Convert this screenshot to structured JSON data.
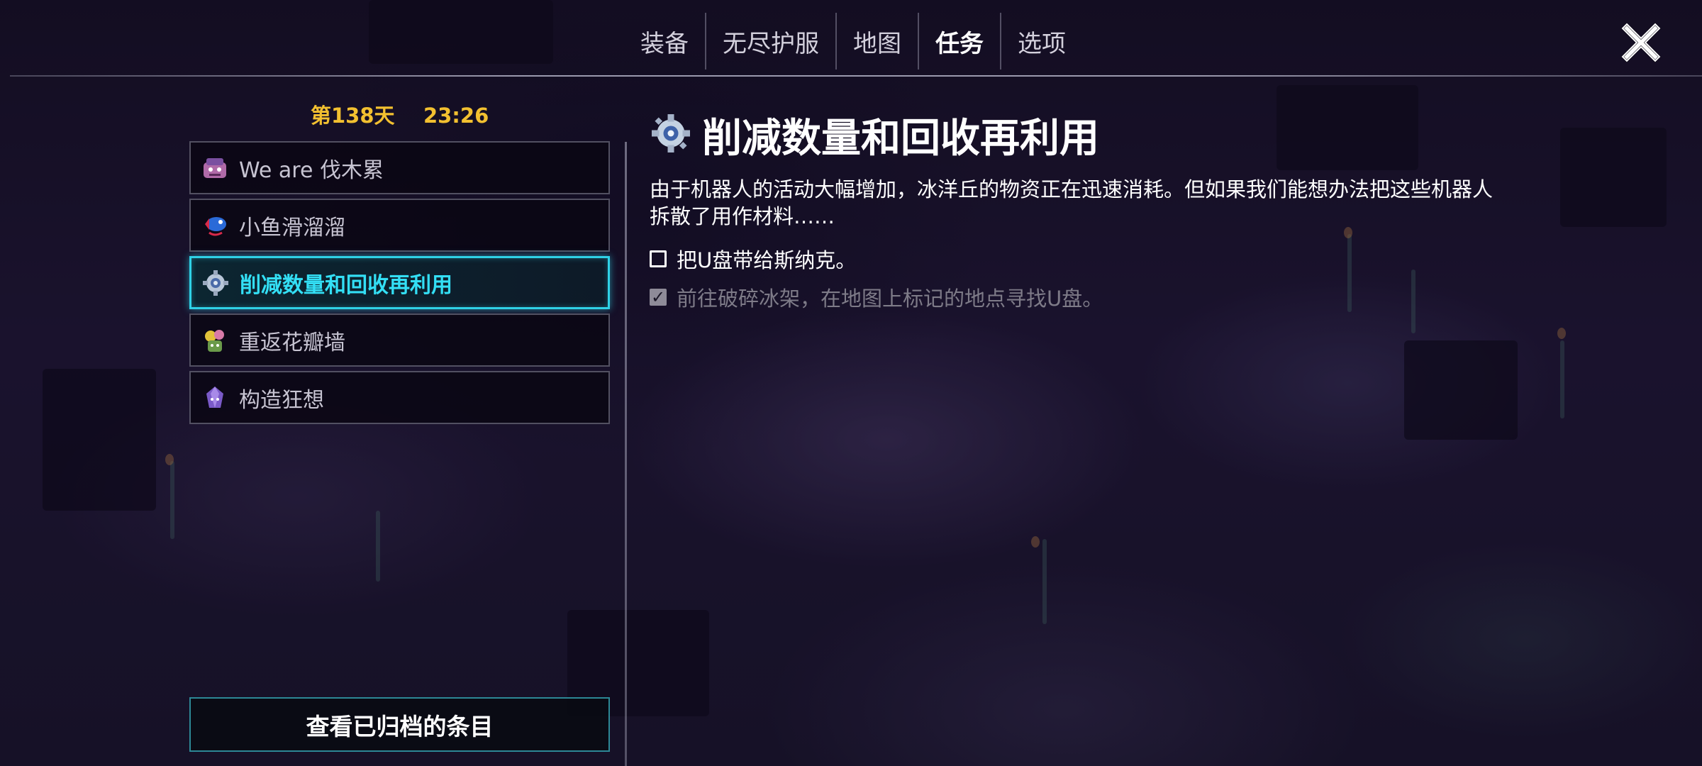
{
  "nav": {
    "tabs": [
      {
        "label": "装备"
      },
      {
        "label": "无尽护服"
      },
      {
        "label": "地图"
      },
      {
        "label": "任务"
      },
      {
        "label": "选项"
      }
    ],
    "active_tab": "任务",
    "close_icon": "close-x-icon"
  },
  "status": {
    "day": "第138天",
    "time": "23:26"
  },
  "quests": [
    {
      "label": "We are 伐木累",
      "icon": "pink-creature-icon"
    },
    {
      "label": "小鱼滑溜溜",
      "icon": "fish-icon"
    },
    {
      "label": "削减数量和回收再利用",
      "icon": "robot-gear-icon"
    },
    {
      "label": "重返花瓣墙",
      "icon": "flower-creature-icon"
    },
    {
      "label": "构造狂想",
      "icon": "crystal-creature-icon"
    }
  ],
  "selected_quest_index": 2,
  "archive_button": "查看已归档的条目",
  "detail": {
    "icon": "robot-gear-icon",
    "title": "削减数量和回收再利用",
    "description": "由于机器人的活动大幅增加，冰洋丘的物资正在迅速消耗。但如果我们能想办法把这些机器人拆散了用作材料……",
    "objectives": [
      {
        "text": "把U盘带给斯纳克。",
        "done": false
      },
      {
        "text": "前往破碎冰架，在地图上标记的地点寻找U盘。",
        "done": true
      }
    ]
  },
  "colors": {
    "accent": "#2fd1e6",
    "time_text": "#f2c030",
    "done_text": "#7e7b88"
  }
}
